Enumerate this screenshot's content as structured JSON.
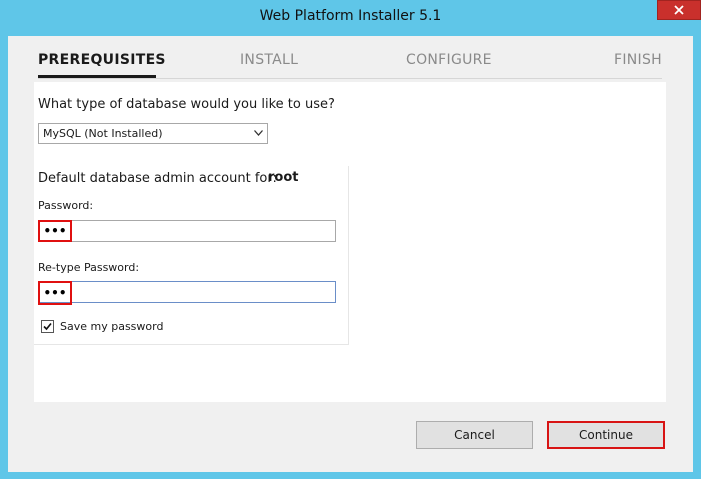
{
  "window": {
    "title": "Web Platform Installer 5.1",
    "close_icon": "close-icon"
  },
  "steps": {
    "items": [
      {
        "label": "PREREQUISITES",
        "active": true
      },
      {
        "label": "INSTALL",
        "active": false
      },
      {
        "label": "CONFIGURE",
        "active": false
      },
      {
        "label": "FINISH",
        "active": false
      }
    ]
  },
  "database": {
    "question": "What type of database would you like to use?",
    "selected": "MySQL (Not Installed)"
  },
  "account": {
    "label": "Default database admin account for:",
    "value": "root"
  },
  "password": {
    "label": "Password:",
    "masked_value": "•••"
  },
  "retype_password": {
    "label": "Re-type Password:",
    "masked_value": "•••"
  },
  "save_password": {
    "label": "Save my password",
    "checked": true
  },
  "buttons": {
    "cancel": "Cancel",
    "continue": "Continue"
  },
  "colors": {
    "frame": "#5fc6e8",
    "highlight": "#e01010"
  }
}
